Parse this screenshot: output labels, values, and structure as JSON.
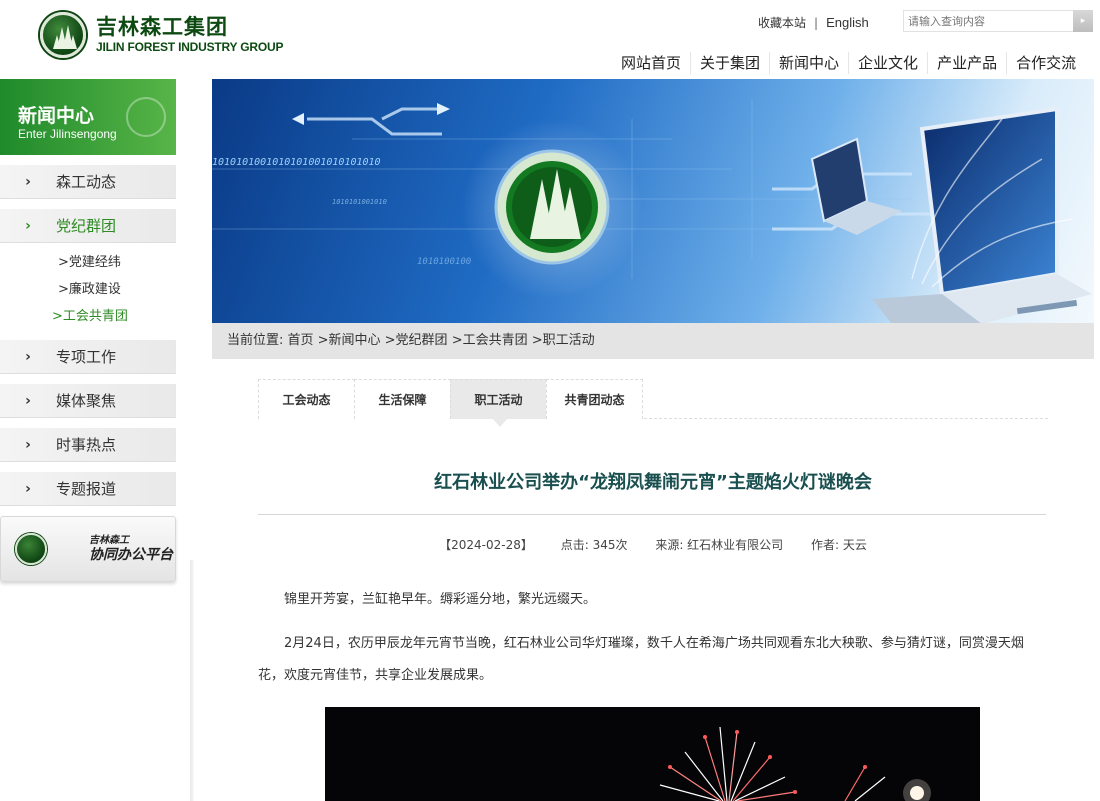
{
  "header": {
    "logo_cn": "吉林森工集团",
    "logo_en": "JILIN FOREST INDUSTRY GROUP",
    "bookmark": "收藏本站",
    "separator": "|",
    "english": "English",
    "search_placeholder": "请输入查询内容",
    "search_go": "▸"
  },
  "nav": [
    "网站首页",
    "关于集团",
    "新闻中心",
    "企业文化",
    "产业产品",
    "合作交流"
  ],
  "sidebar": {
    "title": "新闻中心",
    "subtitle": "Enter Jilinsengong",
    "arrow": "›",
    "items_top": [
      {
        "label": "森工动态"
      },
      {
        "label": "党纪群团"
      }
    ],
    "sub_items": [
      {
        "label": ">党建经纬"
      },
      {
        "label": ">廉政建设"
      },
      {
        "label": ">工会共青团"
      }
    ],
    "items_bottom": [
      {
        "label": "专项工作"
      },
      {
        "label": "媒体聚焦"
      },
      {
        "label": "时事热点"
      },
      {
        "label": "专题报道"
      }
    ],
    "platform_line1": "吉林森工",
    "platform_line2": "协同办公平台"
  },
  "banner": {
    "binary_1": "1010101001010101001010101010",
    "binary_2": "1010101001010",
    "binary_3": "1010100100"
  },
  "breadcrumb": "当前位置: 首页 >新闻中心 >党纪群团 >工会共青团 >职工活动",
  "tabs": [
    {
      "label": "工会动态"
    },
    {
      "label": "生活保障"
    },
    {
      "label": "职工活动"
    },
    {
      "label": "共青团动态"
    }
  ],
  "article": {
    "title": "红石林业公司举办“龙翔凤舞闹元宵”主题焰火灯谜晚会",
    "date": "【2024-02-28】",
    "clicks": "点击: 345次",
    "source": "来源: 红石林业有限公司",
    "author": "作者: 天云",
    "para1": "锦里开芳宴，兰缸艳早年。缛彩遥分地，繁光远缀天。",
    "para2": "2月24日，农历甲辰龙年元宵节当晚，红石林业公司华灯璀璨，数千人在希海广场共同观看东北大秧歌、参与猜灯谜，同赏漫天烟花，欢度元宵佳节，共享企业发展成果。"
  },
  "colors": {
    "brand_green": "#2e8b23",
    "logo_green": "#0d4a12",
    "title_teal": "#1a4f4f"
  }
}
